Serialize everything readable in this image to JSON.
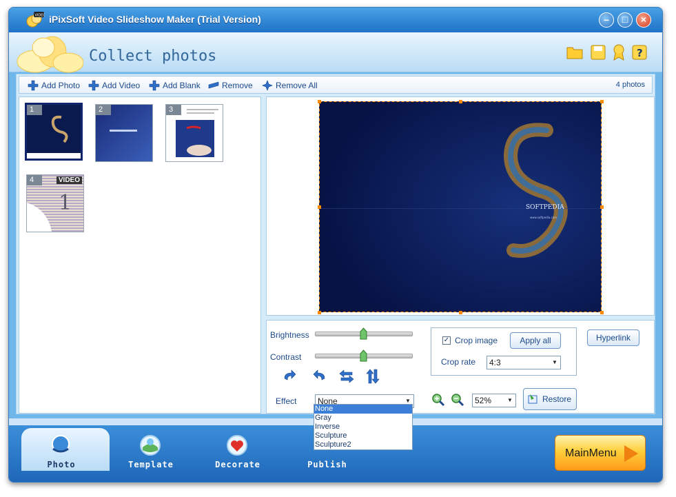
{
  "window": {
    "title": "iPixSoft Video Slideshow Maker (Trial Version)"
  },
  "header": {
    "title": "Collect photos"
  },
  "toolbar": {
    "add_photo": "Add Photo",
    "add_video": "Add Video",
    "add_blank": "Add Blank",
    "remove": "Remove",
    "remove_all": "Remove All",
    "photo_count": "4 photos"
  },
  "thumbnails": [
    {
      "num": "1",
      "selected": true
    },
    {
      "num": "2",
      "selected": false
    },
    {
      "num": "3",
      "selected": false
    },
    {
      "num": "4",
      "selected": false,
      "tag": "VIDEO"
    }
  ],
  "preview": {
    "brand_text": "SOFTPEDIA",
    "brand_url": "www.softpedia.com"
  },
  "edit": {
    "brightness_label": "Brightness",
    "brightness_value": 0.5,
    "contrast_label": "Contrast",
    "contrast_value": 0.5,
    "effect_label": "Effect",
    "effect_selected": "None",
    "effect_options": [
      "None",
      "Gray",
      "Inverse",
      "Sculpture",
      "Sculpture2"
    ],
    "crop_image_label": "Crop image",
    "crop_image_checked": true,
    "apply_all": "Apply all",
    "crop_rate_label": "Crop rate",
    "crop_rate_value": "4:3",
    "hyperlink": "Hyperlink",
    "zoom_value": "52%",
    "restore": "Restore"
  },
  "nav": {
    "photo": "Photo",
    "template": "Template",
    "decorate": "Decorate",
    "publish": "Publish",
    "mainmenu": "MainMenu"
  },
  "colors": {
    "window_blue": "#1f72c8",
    "panel_bg": "#d6ebfa",
    "selection": "#3c7fd8",
    "mainmenu_orange": "#ffcf3a"
  }
}
